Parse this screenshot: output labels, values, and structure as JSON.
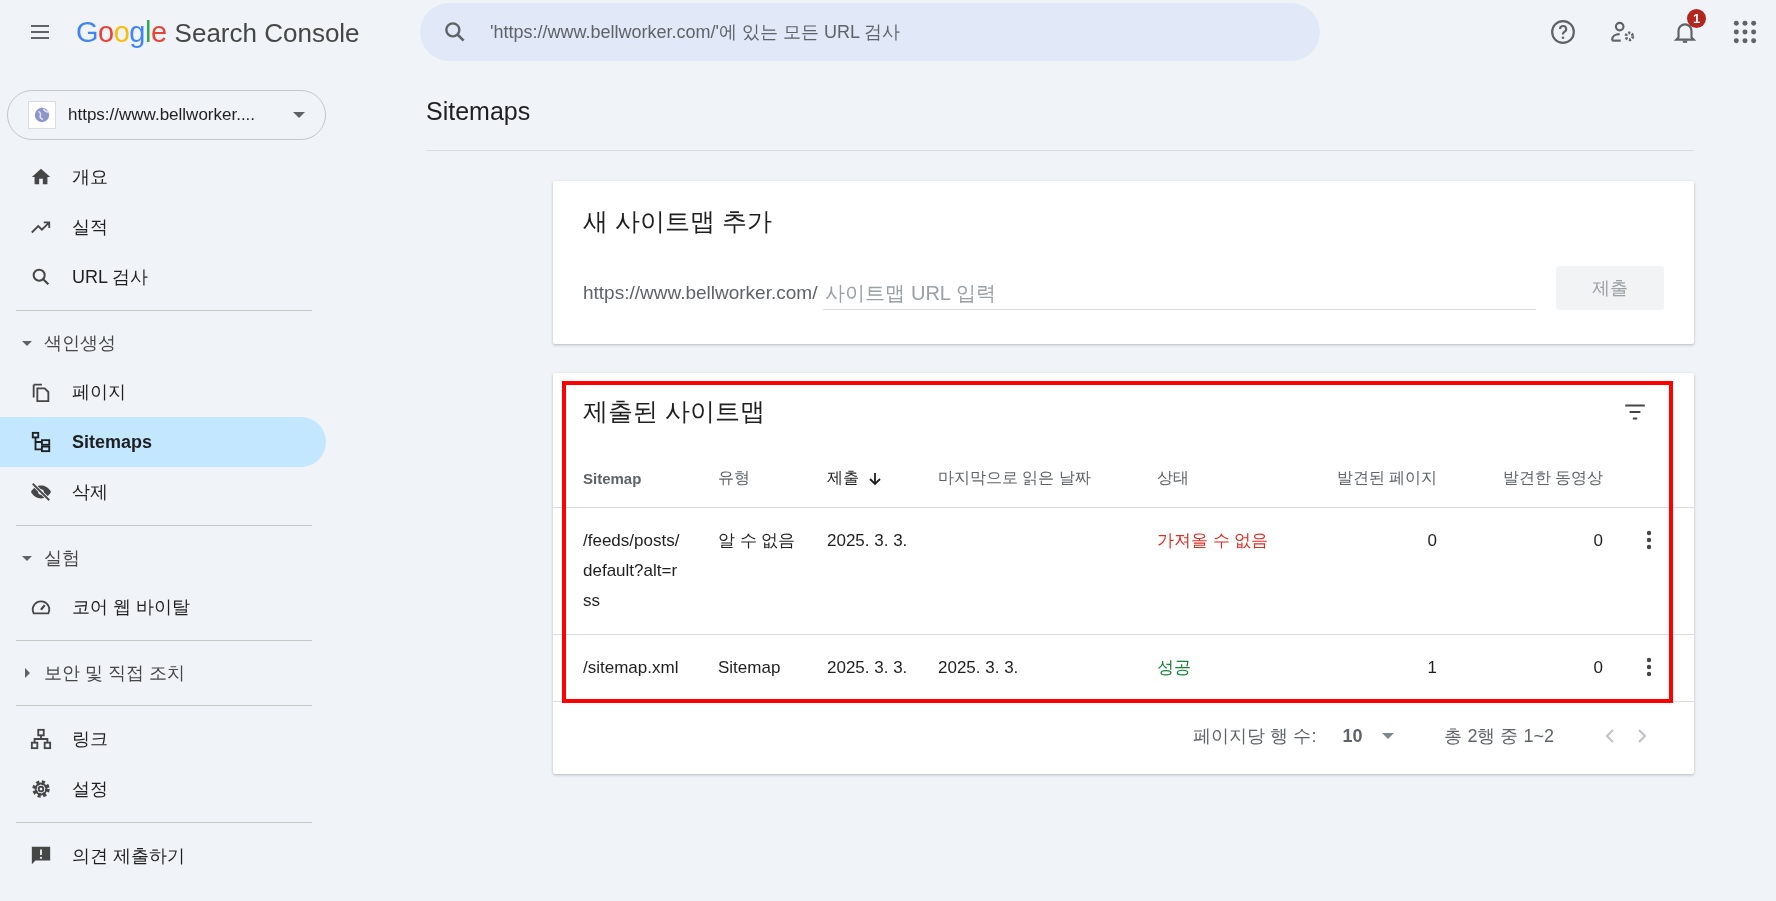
{
  "header": {
    "product": "Search Console",
    "logo_letters": [
      {
        "ch": "G",
        "color": "#4285f4"
      },
      {
        "ch": "o",
        "color": "#ea4335"
      },
      {
        "ch": "o",
        "color": "#fbbc05"
      },
      {
        "ch": "g",
        "color": "#4285f4"
      },
      {
        "ch": "l",
        "color": "#34a853"
      },
      {
        "ch": "e",
        "color": "#ea4335"
      }
    ],
    "search": {
      "placeholder": "'https://www.bellworker.com/'에 있는 모든 URL 검사"
    },
    "notification_count": "1"
  },
  "property": {
    "label": "https://www.bellworker...."
  },
  "sidebar": {
    "groups": [
      {
        "items": [
          {
            "label": "개요",
            "selected": false
          },
          {
            "label": "실적",
            "selected": false
          },
          {
            "label": "URL 검사",
            "selected": false
          }
        ]
      },
      {
        "title": "색인생성",
        "expanded": true,
        "items": [
          {
            "label": "페이지",
            "selected": false
          },
          {
            "label": "Sitemaps",
            "selected": true
          },
          {
            "label": "삭제",
            "selected": false
          }
        ]
      },
      {
        "title": "실험",
        "expanded": true,
        "items": [
          {
            "label": "코어 웹 바이탈",
            "selected": false
          }
        ]
      },
      {
        "title": "보안 및 직접 조치",
        "expanded": false
      },
      {
        "items": [
          {
            "label": "링크",
            "selected": false
          },
          {
            "label": "설정",
            "selected": false
          }
        ]
      },
      {
        "items": [
          {
            "label": "의견 제출하기",
            "selected": false
          }
        ]
      }
    ]
  },
  "page_title": "Sitemaps",
  "add_card": {
    "title": "새 사이트맵 추가",
    "prefix": "https://www.bellworker.com/",
    "placeholder": "사이트맵 URL 입력",
    "submit": "제출",
    "submit_disabled": true
  },
  "submitted_card": {
    "title": "제출된 사이트맵",
    "highlighted": true,
    "table": {
      "columns": [
        {
          "label": "Sitemap",
          "sorted": false
        },
        {
          "label": "유형",
          "sorted": false
        },
        {
          "label": "제출",
          "sorted": true
        },
        {
          "label": "마지막으로 읽은 날짜",
          "sorted": false
        },
        {
          "label": "상태",
          "sorted": false
        },
        {
          "label": "발견된 페이지",
          "sorted": false
        },
        {
          "label": "발견한 동영상",
          "sorted": false
        }
      ],
      "rows": [
        {
          "cells": [
            "/feeds/posts/default?alt=rss",
            "알 수 없음",
            "2025. 3. 3.",
            "",
            "가져올 수 없음",
            "0",
            "0"
          ],
          "color": "#d93025"
        },
        {
          "cells": [
            "/sitemap.xml",
            "Sitemap",
            "2025. 3. 3.",
            "2025. 3. 3.",
            "성공",
            "1",
            "0"
          ],
          "color": "#188038"
        }
      ]
    },
    "pagination": {
      "rows_per_page_label": "페이지당 행 수:",
      "rows_per_page": "10",
      "range": "총 2행 중 1~2"
    }
  }
}
